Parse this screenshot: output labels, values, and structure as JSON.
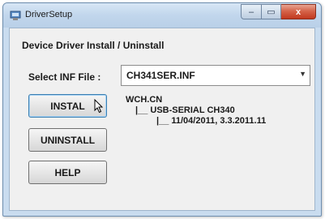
{
  "window": {
    "title": "DriverSetup",
    "minimize_glyph": "–",
    "maximize_glyph": "▭",
    "close_glyph": "x"
  },
  "group": {
    "heading": "Device Driver Install / Uninstall"
  },
  "select_inf": {
    "label": "Select INF File :",
    "value": "CH341SER.INF"
  },
  "buttons": {
    "install": "INSTAL",
    "uninstall": "UNINSTALL",
    "help": "HELP"
  },
  "tree": {
    "line1": "WCH.CN",
    "line2": "|__ USB-SERIAL CH340",
    "line3": "|__ 11/04/2011, 3.3.2011.11"
  },
  "icons": {
    "app": "driver-setup-app-icon",
    "dropdown": "chevron-down-icon",
    "cursor": "mouse-pointer-icon"
  }
}
